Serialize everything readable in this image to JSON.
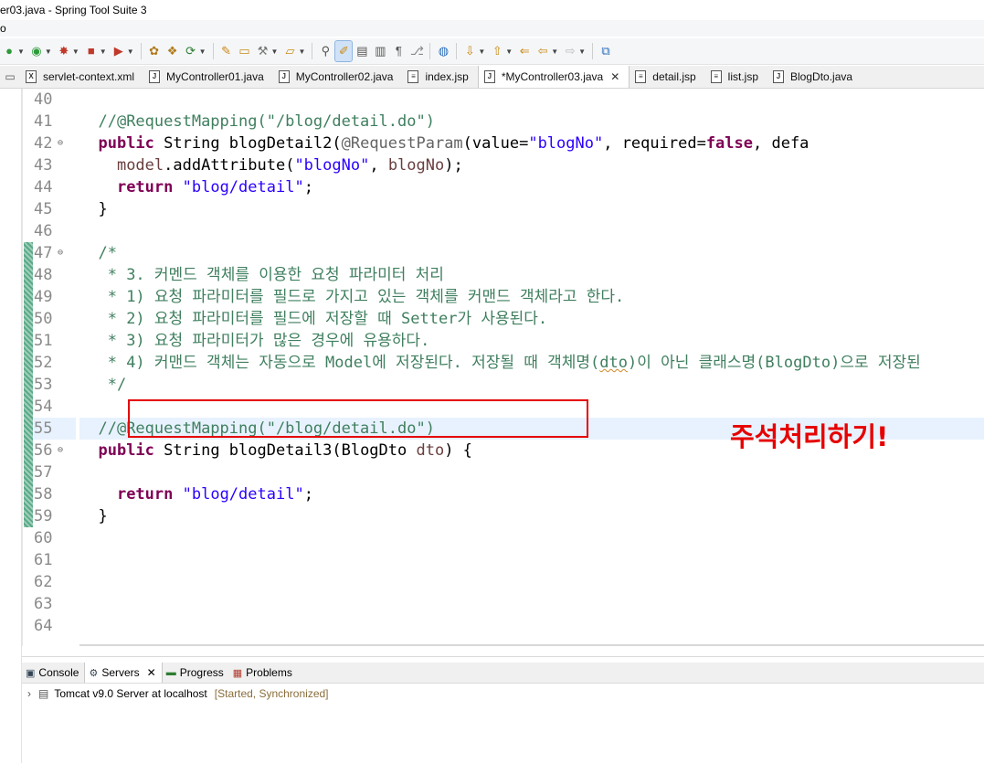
{
  "window": {
    "title": "er03.java - Spring Tool Suite 3",
    "menu_fragment": "o"
  },
  "toolbar": {
    "buttons": [
      "run-icon",
      "debug-icon",
      "stop-icon",
      "deploy-icon",
      "new-package-icon",
      "new-class-icon",
      "refresh-icon",
      "open-type-icon",
      "open-folder-icon",
      "tools-icon",
      "folder-icon",
      "pin-icon",
      "mark-occurrences-icon",
      "show-whitespace-icon",
      "pilcrow-icon",
      "git-icon",
      "globe-icon",
      "next-annotation-icon",
      "prev-annotation-icon",
      "last-edit-icon",
      "back-icon",
      "forward-icon",
      "new-window-icon"
    ]
  },
  "tabs": [
    {
      "label": "servlet-context.xml",
      "icon": "X"
    },
    {
      "label": "MyController01.java",
      "icon": "J"
    },
    {
      "label": "MyController02.java",
      "icon": "J"
    },
    {
      "label": "index.jsp",
      "icon": "≡"
    },
    {
      "label": "*MyController03.java",
      "icon": "J",
      "active": true,
      "close": "✕"
    },
    {
      "label": "detail.jsp",
      "icon": "≡"
    },
    {
      "label": "list.jsp",
      "icon": "≡"
    },
    {
      "label": "BlogDto.java",
      "icon": "J"
    }
  ],
  "editor": {
    "line_numbers": [
      "40",
      "41",
      "42",
      "43",
      "44",
      "45",
      "46",
      "47",
      "48",
      "49",
      "50",
      "51",
      "52",
      "53",
      "54",
      "55",
      "56",
      "57",
      "58",
      "59",
      "60",
      "61",
      "62",
      "63",
      "64"
    ],
    "fold_marks": [
      "⊖",
      "⊖",
      "⊖"
    ],
    "code": {
      "l41": "//@RequestMapping(\"/blog/detail.do\")",
      "l42_kw": "public",
      "l42_a": " String blogDetail2(",
      "l42_ann": "@RequestParam",
      "l42_b": "(value=",
      "l42_str": "\"blogNo\"",
      "l42_c": ", required=",
      "l42_false": "false",
      "l42_d": ", defa",
      "l43_var": "model",
      "l43_a": ".addAttribute(",
      "l43_str": "\"blogNo\"",
      "l43_b": ", ",
      "l43_var2": "blogNo",
      "l43_c": ");",
      "l44_kw": "return",
      "l44_str": "\"blog/detail\"",
      "l44_end": ";",
      "l45": "}",
      "l47": "/*",
      "l48": " * 3. 커멘드 객체를 이용한 요청 파라미터 처리",
      "l49": " * 1) 요청 파라미터를 필드로 가지고 있는 객체를 커맨드 객체라고 한다.",
      "l50_a": " * 2) 요청 파라미터를 필드에 저장할 때 ",
      "l50_b": "Setter",
      "l50_c": "가 사용된다.",
      "l51": " * 3) 요청 파라미터가 많은 경우에 유용하다.",
      "l52_a": " * 4) 커맨드 객체는 자동으로 ",
      "l52_b": "Model",
      "l52_c": "에 저장된다. 저장될 때 객체명(",
      "l52_d": "dto",
      "l52_e": ")이 아닌 클래스명(",
      "l52_f": "BlogDto",
      "l52_g": ")으로 저장된",
      "l53": " */",
      "l55": "//@RequestMapping(\"/blog/detail.do\")",
      "l56_kw": "public",
      "l56_a": " String blogDetail3(BlogDto ",
      "l56_var": "dto",
      "l56_b": ") {",
      "l58_kw": "return",
      "l58_str": "\"blog/detail\"",
      "l58_end": ";",
      "l59": "}"
    }
  },
  "annotation": {
    "text": "주석처리하기!",
    "color": "#e60000"
  },
  "bottom": {
    "tabs": [
      {
        "label": "Console",
        "icon": "console-icon"
      },
      {
        "label": "Servers",
        "icon": "servers-icon",
        "active": true,
        "close": "✕"
      },
      {
        "label": "Progress",
        "icon": "progress-icon"
      },
      {
        "label": "Problems",
        "icon": "problems-icon"
      }
    ],
    "server": {
      "name": "Tomcat v9.0 Server at localhost",
      "status": "[Started, Synchronized]"
    }
  },
  "colors": {
    "keyword": "#7f0055",
    "string": "#2a00ff",
    "comment": "#3f7f5f",
    "javadoc": "#3f5fbf",
    "annotation": "#646464",
    "current_line": "#e8f2fe"
  }
}
